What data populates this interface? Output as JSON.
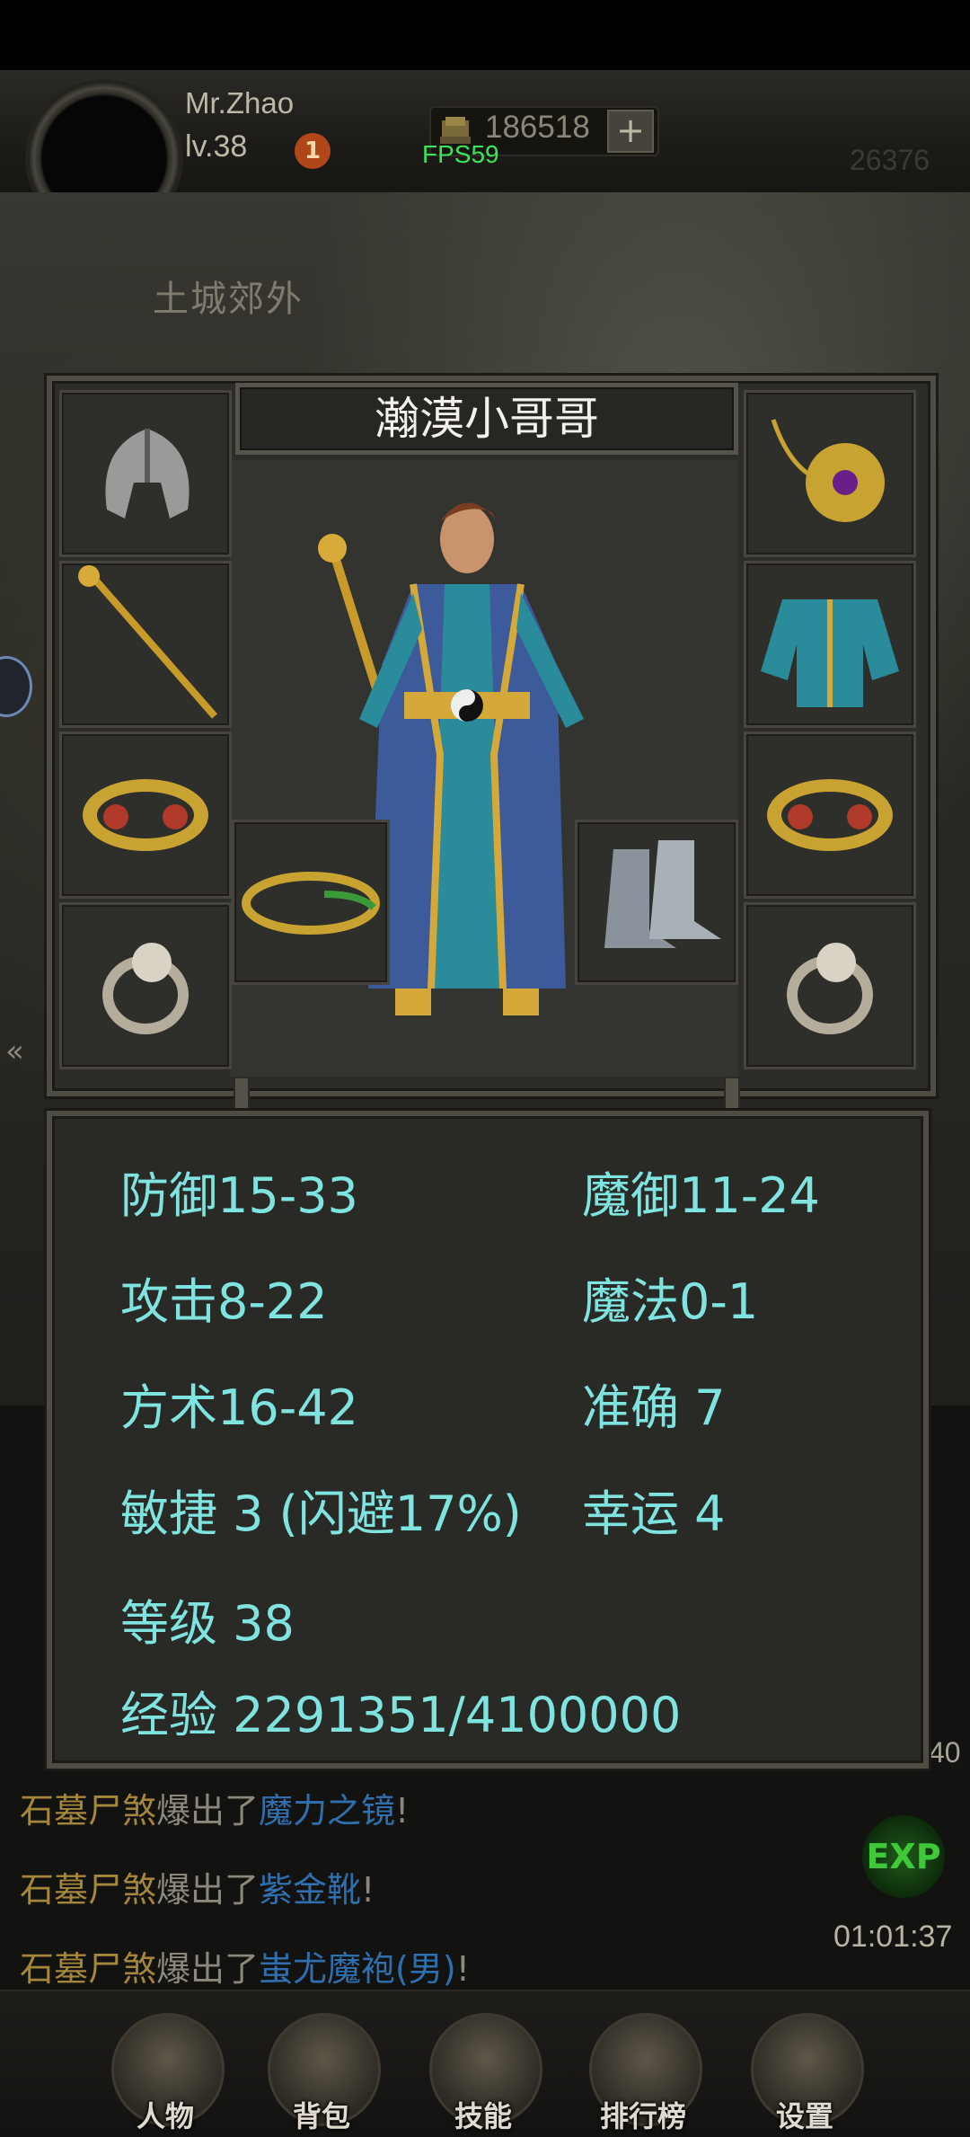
{
  "hud": {
    "player_name": "Mr.Zhao",
    "player_level": "lv.38",
    "notify_count": "1",
    "gold": "186518",
    "gold_add": "+",
    "fps": "FPS59",
    "right_value": "26376"
  },
  "map": {
    "name": "土城郊外"
  },
  "equipment": {
    "character_name": "瀚漠小哥哥",
    "slots": [
      {
        "name": "helmet-slot",
        "icon": "helmet-icon"
      },
      {
        "name": "necklace-slot",
        "icon": "necklace-icon"
      },
      {
        "name": "weapon-slot",
        "icon": "staff-icon"
      },
      {
        "name": "armor-slot",
        "icon": "robe-icon"
      },
      {
        "name": "left-bracelet-slot",
        "icon": "bracelet-icon"
      },
      {
        "name": "right-bracelet-slot",
        "icon": "bracelet-icon"
      },
      {
        "name": "left-ring-slot",
        "icon": "ring-icon"
      },
      {
        "name": "right-ring-slot",
        "icon": "ring-icon"
      },
      {
        "name": "belt-slot",
        "icon": "belt-icon"
      },
      {
        "name": "boots-slot",
        "icon": "boots-icon"
      }
    ]
  },
  "stats": {
    "defense": "防御15-33",
    "magic_defense": "魔御11-24",
    "attack": "攻击8-22",
    "magic": "魔法0-1",
    "taoism": "方术16-42",
    "accuracy": "准确 7",
    "agility": "敏捷 3 (闪避17%)",
    "luck": "幸运 4",
    "level": "等级 38",
    "experience": "经验 2291351/4100000"
  },
  "chat": [
    {
      "mob": "石墓尸煞",
      "verb": "爆出了",
      "item": "魔力之镜",
      "end": "!"
    },
    {
      "mob": "石墓尸煞",
      "verb": "爆出了",
      "item": "紫金靴",
      "end": "!"
    },
    {
      "mob": "石墓尸煞",
      "verb": "爆出了",
      "item": "蚩尤魔袍(男)",
      "end": "!"
    }
  ],
  "chat_time": "01:01:37",
  "side_value": "40",
  "exp_button": "EXP",
  "nav": {
    "character": "人物",
    "bag": "背包",
    "skills": "技能",
    "ranking": "排行榜",
    "settings": "设置"
  }
}
